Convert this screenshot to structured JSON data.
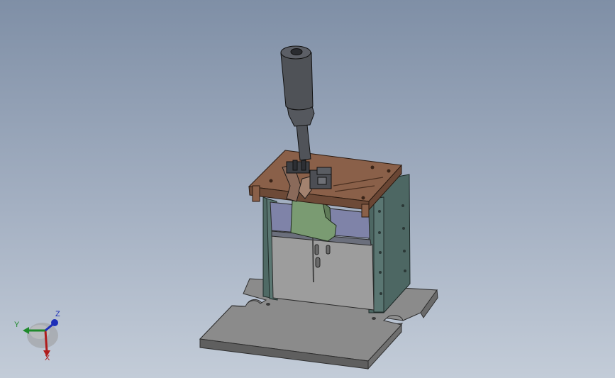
{
  "viewport": {
    "background_top": "#7f8fa6",
    "background_bottom": "#c3ccd8"
  },
  "model": {
    "plate_color": "#8c8c8c",
    "frame_color": "#4f6a65",
    "top_plate_color": "#8a6049",
    "window_color": "#7f83a8",
    "slider_color": "#7a9b72",
    "handle_color": "#4f5257"
  },
  "triad": {
    "x_label": "X",
    "y_label": "Y",
    "z_label": "Z",
    "x_color": "#b01c1c",
    "y_color": "#1f8a2c",
    "z_color": "#1d2fb8"
  }
}
